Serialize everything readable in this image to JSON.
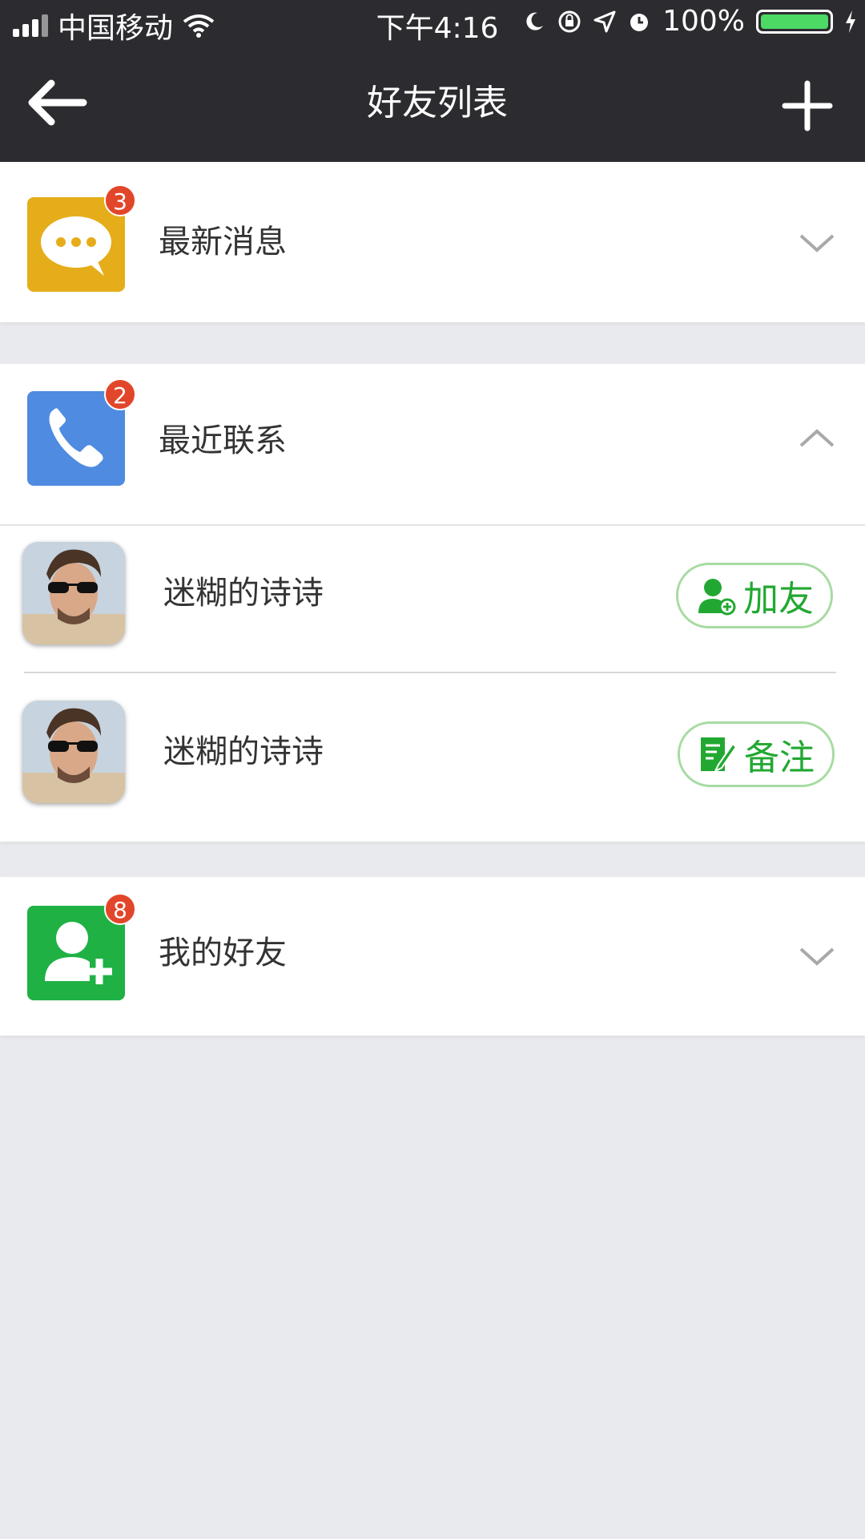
{
  "status_bar": {
    "carrier": "中国移动",
    "time": "下午4:16",
    "battery": "100%"
  },
  "nav": {
    "title": "好友列表"
  },
  "sections": [
    {
      "label": "最新消息",
      "badge": "3",
      "icon": "chat-bubble-icon",
      "color": "#e6ad1a",
      "expanded": false
    },
    {
      "label": "最近联系",
      "badge": "2",
      "icon": "phone-icon",
      "color": "#4f8be0",
      "expanded": true
    },
    {
      "label": "我的好友",
      "badge": "8",
      "icon": "add-user-icon",
      "color": "#1fb144",
      "expanded": false
    }
  ],
  "contacts": [
    {
      "name": "迷糊的诗诗",
      "action": "加友",
      "action_icon": "add-friend-icon"
    },
    {
      "name": "迷糊的诗诗",
      "action": "备注",
      "action_icon": "edit-note-icon"
    }
  ],
  "colors": {
    "bar": "#2c2c30",
    "background": "#e9eaee",
    "accent_green": "#22a832",
    "badge": "#e2462a"
  }
}
